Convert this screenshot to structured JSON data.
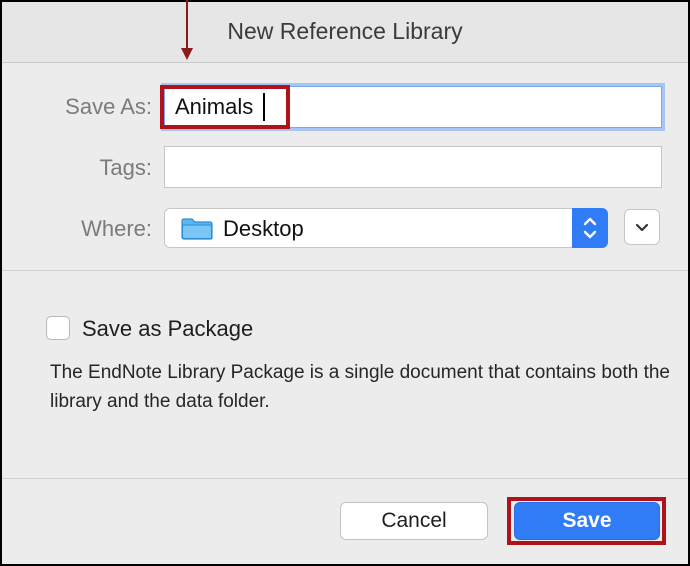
{
  "window": {
    "title": "New Reference Library"
  },
  "form": {
    "save_as_label": "Save As:",
    "save_as_value": "Animals",
    "tags_label": "Tags:",
    "tags_value": "",
    "where_label": "Where:",
    "where_value": "Desktop"
  },
  "options": {
    "package_label": "Save as Package",
    "package_checked": false,
    "description": "The EndNote Library Package is a single document that contains both the library and the data folder."
  },
  "buttons": {
    "cancel_label": "Cancel",
    "save_label": "Save"
  },
  "icons": {
    "location": "folder-icon",
    "stepper": "up-down-chevron-icon",
    "expand": "chevron-down-icon",
    "annotation": "down-arrow-icon"
  },
  "colors": {
    "accent": "#2f7cf6",
    "annotation": "#b0121b",
    "dialog_background": "#ececec"
  }
}
